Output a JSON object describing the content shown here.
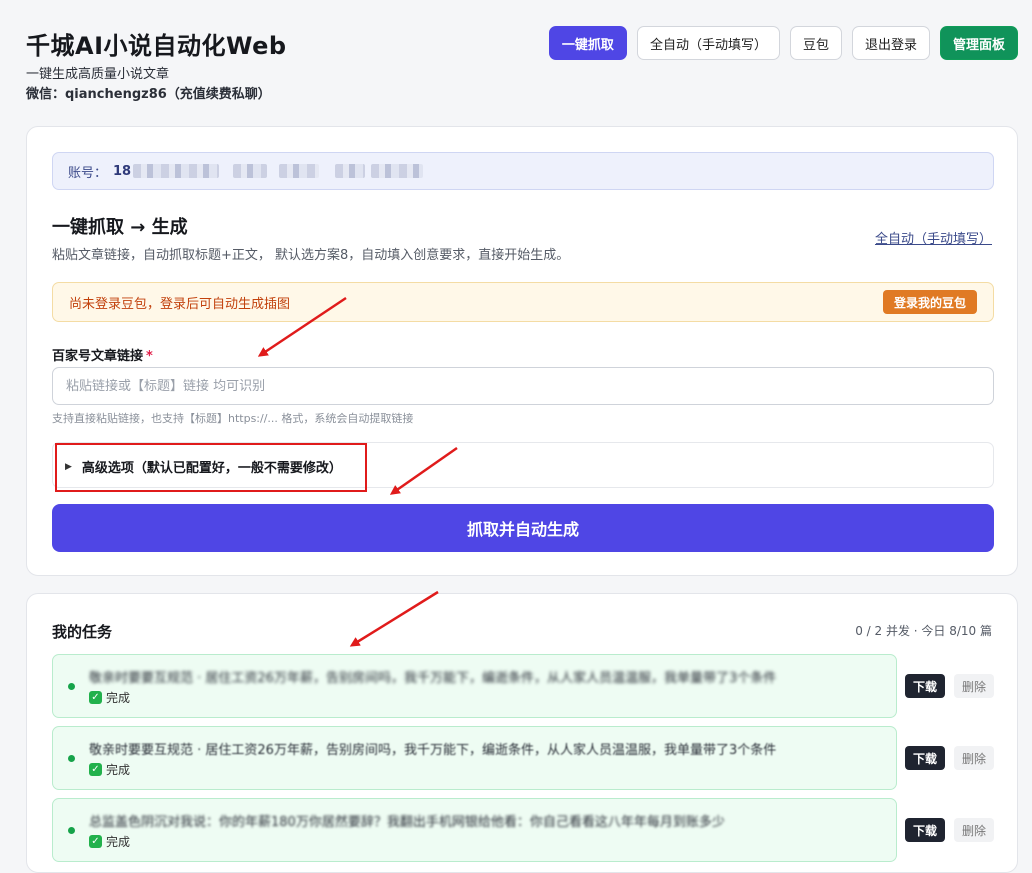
{
  "header": {
    "title": "千城AI小说自动化Web",
    "subtitle": "一键生成高质量小说文章",
    "wechat": "微信：qianchengz86（充值续费私聊）",
    "nav": [
      "一键抓取",
      "全自动（手动填写）",
      "豆包",
      "退出登录",
      "管理面板"
    ]
  },
  "main": {
    "account_label": "账号：",
    "account_value": "18",
    "section_title": "一键抓取 → 生成",
    "section_desc": "粘贴文章链接，自动抓取标题+正文， 默认选方案8，自动填入创意要求，直接开始生成。",
    "section_link": "全自动（手动填写）",
    "warning_text": "尚未登录豆包，登录后可自动生成插图",
    "warning_button": "登录我的豆包",
    "field_label": "百家号文章链接",
    "field_required": "*",
    "field_placeholder": "粘贴链接或【标题】链接 均可识别",
    "field_hint": "支持直接粘贴链接，也支持【标题】https://... 格式，系统会自动提取链接",
    "advanced_label": "高级选项（默认已配置好，一般不需要修改）",
    "submit_label": "抓取并自动生成"
  },
  "tasks": {
    "title": "我的任务",
    "stats": "0 / 2 并发 · 今日 8/10 篇",
    "download_label": "下载",
    "delete_label": "删除",
    "items": [
      {
        "text": "敬亲时要要互规范 · 居住工资26万年薪，告别房间吗，我千万能下，编逝条件，从人家人员温温服，我单量带了3个条件",
        "status": "完成"
      },
      {
        "text": "敬亲时要要互规范 · 居住工资26万年薪，告别房间吗，我千万能下，编逝条件，从人家人员温温服，我单量带了3个条件",
        "status": "完成"
      },
      {
        "text": "总监盖色阴沉对我说：你的年薪180万你居然要辞？我翻出手机网银给他看：你自己看看这八年年每月到账多少",
        "status": "完成"
      }
    ]
  },
  "colors": {
    "primary": "#4f46e5",
    "admin_green": "#10935a",
    "warning_bg": "#fff8e8",
    "warning_button": "#e07a24",
    "task_bg": "#eefcf3",
    "annotation_red": "#e01b1b"
  },
  "icons": {
    "advanced_toggle": "triangle-right-icon",
    "task_status": "check-box-icon",
    "task_state": "green-dot-icon"
  }
}
